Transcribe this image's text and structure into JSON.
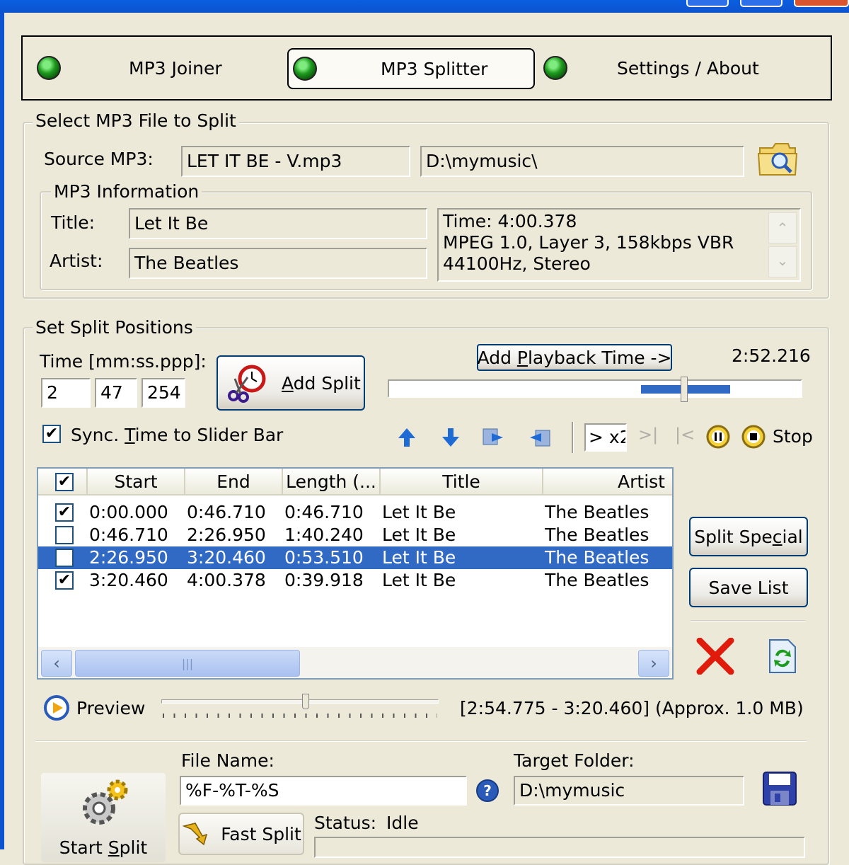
{
  "nav": {
    "joiner": "MP3 Joiner",
    "splitter": "MP3 Splitter",
    "settings": "Settings / About"
  },
  "select_group": {
    "title": "Select MP3 File to Split",
    "source_label": "Source MP3:",
    "source_file": "LET IT BE - V.mp3",
    "source_path": "D:\\mymusic\\"
  },
  "info_group": {
    "title": "MP3 Information",
    "title_label": "Title:",
    "title_value": "Let It Be",
    "artist_label": "Artist:",
    "artist_value": "The Beatles",
    "details_line1": "Time: 4:00.378",
    "details_line2": "MPEG 1.0, Layer 3, 158kbps VBR",
    "details_line3": "44100Hz, Stereo"
  },
  "split_group": {
    "title": "Set Split Positions",
    "time_label": "Time [mm:ss.ppp]:",
    "time_min": "2",
    "time_sec": "47",
    "time_ms": "254",
    "add_split_label": "Add Split",
    "add_split_access": "A",
    "add_split_rest": "dd Split",
    "add_playback_pre": "Add ",
    "add_playback_access": "P",
    "add_playback_post": "layback Time ->",
    "playback_time": "2:52.216",
    "playback_position_fraction": 0.72,
    "sync_checked": true,
    "sync_pre": "Sync. ",
    "sync_access": "T",
    "sync_post": "ime to Slider Bar",
    "speed_label": "> x2",
    "stop_label": "Stop"
  },
  "list": {
    "columns": [
      "Start",
      "End",
      "Length (...",
      "Title",
      "Artist"
    ],
    "rows": [
      {
        "checked": true,
        "start": "0:00.000",
        "end": "0:46.710",
        "length": "0:46.710",
        "title": "Let It Be",
        "artist": "The Beatles",
        "selected": false
      },
      {
        "checked": false,
        "start": "0:46.710",
        "end": "2:26.950",
        "length": "1:40.240",
        "title": "Let It Be",
        "artist": "The Beatles",
        "selected": false
      },
      {
        "checked": true,
        "start": "2:26.950",
        "end": "3:20.460",
        "length": "0:53.510",
        "title": "Let It Be",
        "artist": "The Beatles",
        "selected": true
      },
      {
        "checked": true,
        "start": "3:20.460",
        "end": "4:00.378",
        "length": "0:39.918",
        "title": "Let It Be",
        "artist": "The Beatles",
        "selected": false
      }
    ]
  },
  "side_buttons": {
    "split_special_pre": "Split Spe",
    "split_special_access": "c",
    "split_special_post": "ial",
    "save_list": "Save List"
  },
  "preview": {
    "label": "Preview",
    "range_text": "[2:54.775 - 3:20.460] (Approx. 1.0 MB)",
    "position_fraction": 0.52
  },
  "output": {
    "file_name_label": "File Name:",
    "file_name_value": "%F-%T-%S",
    "target_folder_label": "Target Folder:",
    "target_folder_value": "D:\\mymusic",
    "start_split_pre": "Start ",
    "start_split_access": "S",
    "start_split_post": "plit",
    "fast_split_label": "Fast Split",
    "status_label": "Status:",
    "status_value": "Idle"
  },
  "colors": {
    "accent_selection": "#316AC5",
    "window_bg": "#ECE9D8",
    "led_green": "#1E9A1E",
    "delete_red": "#E01B0B"
  }
}
